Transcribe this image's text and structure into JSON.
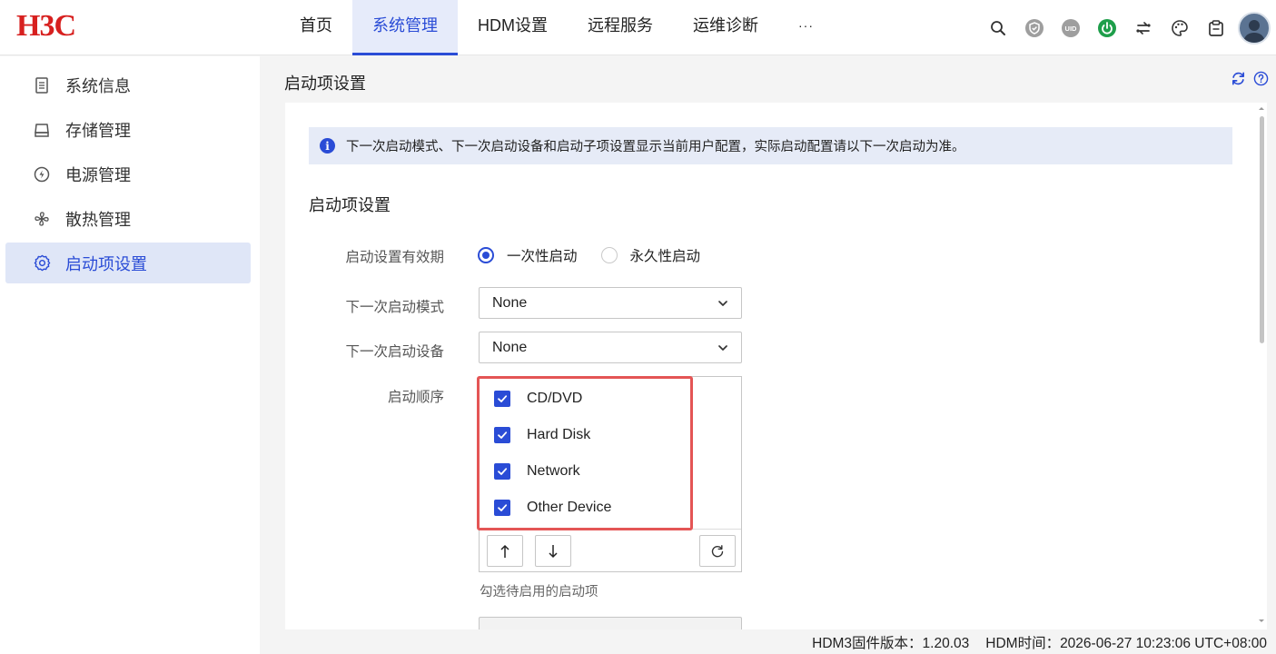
{
  "header": {
    "logo": "H3C",
    "nav": [
      {
        "label": "首页"
      },
      {
        "label": "系统管理"
      },
      {
        "label": "HDM设置"
      },
      {
        "label": "远程服务"
      },
      {
        "label": "运维诊断"
      },
      {
        "label": "···"
      }
    ],
    "active_nav": "系统管理",
    "status_icons": [
      {
        "name": "search-icon"
      },
      {
        "name": "security-shield-icon",
        "color": "#9e9e9e"
      },
      {
        "name": "uid-icon",
        "label": "UID",
        "color": "#9e9e9e"
      },
      {
        "name": "power-icon",
        "color": "#1e9e4a"
      },
      {
        "name": "switch-icon"
      },
      {
        "name": "theme-palette-icon"
      },
      {
        "name": "clipboard-icon"
      }
    ]
  },
  "sidebar": {
    "items": [
      {
        "label": "系统信息",
        "icon": "document-icon"
      },
      {
        "label": "存储管理",
        "icon": "storage-icon"
      },
      {
        "label": "电源管理",
        "icon": "power-circle-icon"
      },
      {
        "label": "散热管理",
        "icon": "fan-icon"
      },
      {
        "label": "启动项设置",
        "icon": "gear-icon"
      }
    ],
    "active": "启动项设置"
  },
  "page": {
    "title": "启动项设置",
    "info": "下一次启动模式、下一次启动设备和启动子项设置显示当前用户配置，实际启动配置请以下一次启动为准。",
    "section_title": "启动项设置"
  },
  "form": {
    "validity_label": "启动设置有效期",
    "validity_options": [
      {
        "label": "一次性启动",
        "checked": true
      },
      {
        "label": "永久性启动",
        "checked": false
      }
    ],
    "boot_mode_label": "下一次启动模式",
    "boot_mode_value": "None",
    "boot_device_label": "下一次启动设备",
    "boot_device_value": "None",
    "boot_order_label": "启动顺序",
    "boot_order": [
      {
        "label": "CD/DVD",
        "checked": true
      },
      {
        "label": "Hard Disk",
        "checked": true
      },
      {
        "label": "Network",
        "checked": true
      },
      {
        "label": "Other Device",
        "checked": true
      }
    ],
    "boot_order_hint": "勾选待启用的启动项"
  },
  "status_bar": {
    "firmware": "HDM3固件版本：1.20.03",
    "time": "HDM时间：2026-06-27 10:23:06 UTC+08:00"
  },
  "colors": {
    "accent": "#2a4cd6",
    "highlight": "#e45555",
    "power_green": "#1e9e4a"
  }
}
